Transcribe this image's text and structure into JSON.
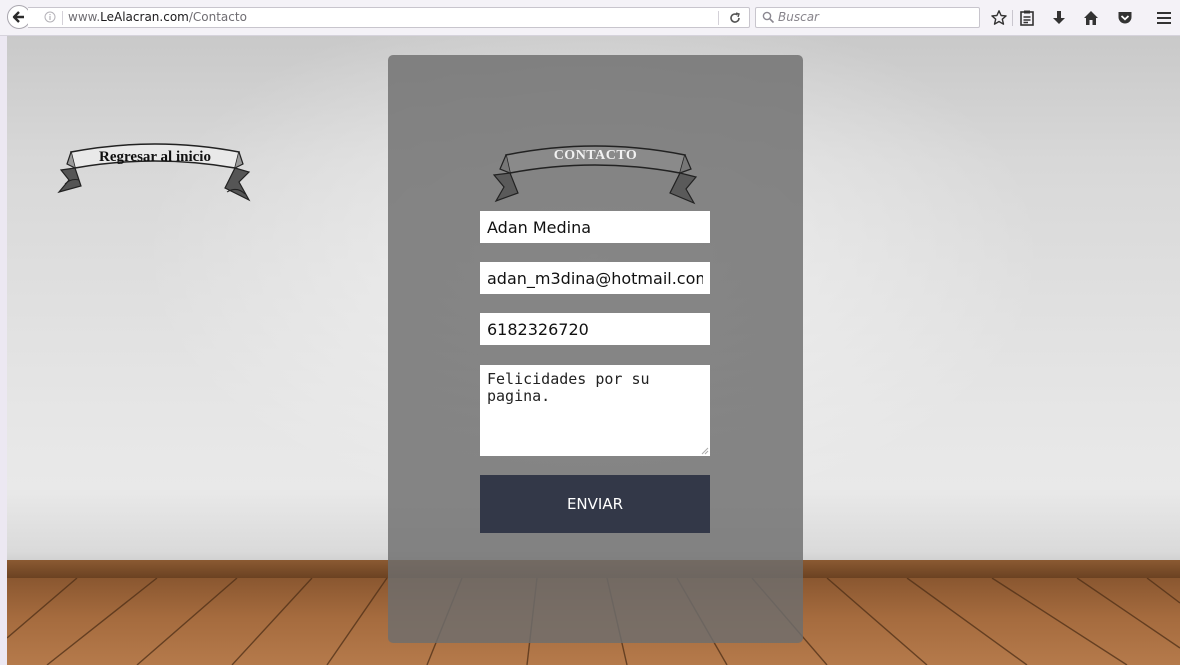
{
  "browser": {
    "url_prefix": "www.",
    "url_domain": "LeAlacran.com",
    "url_path": "/Contacto",
    "search_placeholder": "Buscar",
    "icons": [
      "back-arrow-icon",
      "info-icon",
      "reload-icon",
      "search-icon",
      "star-icon",
      "reading-list-icon",
      "download-icon",
      "home-icon",
      "pocket-icon",
      "menu-icon"
    ]
  },
  "nav": {
    "back_label": "Regresar al inicio"
  },
  "contact": {
    "title": "CONTACTO",
    "name_value": "Adan Medina",
    "email_value": "adan_m3dina@hotmail.com",
    "phone_value": "6182326720",
    "message_value": "Felicidades por su pagina.",
    "submit_label": "ENVIAR"
  },
  "colors": {
    "panel": "#6e6e6e",
    "button": "#333848",
    "floor": "#a56b3e"
  }
}
